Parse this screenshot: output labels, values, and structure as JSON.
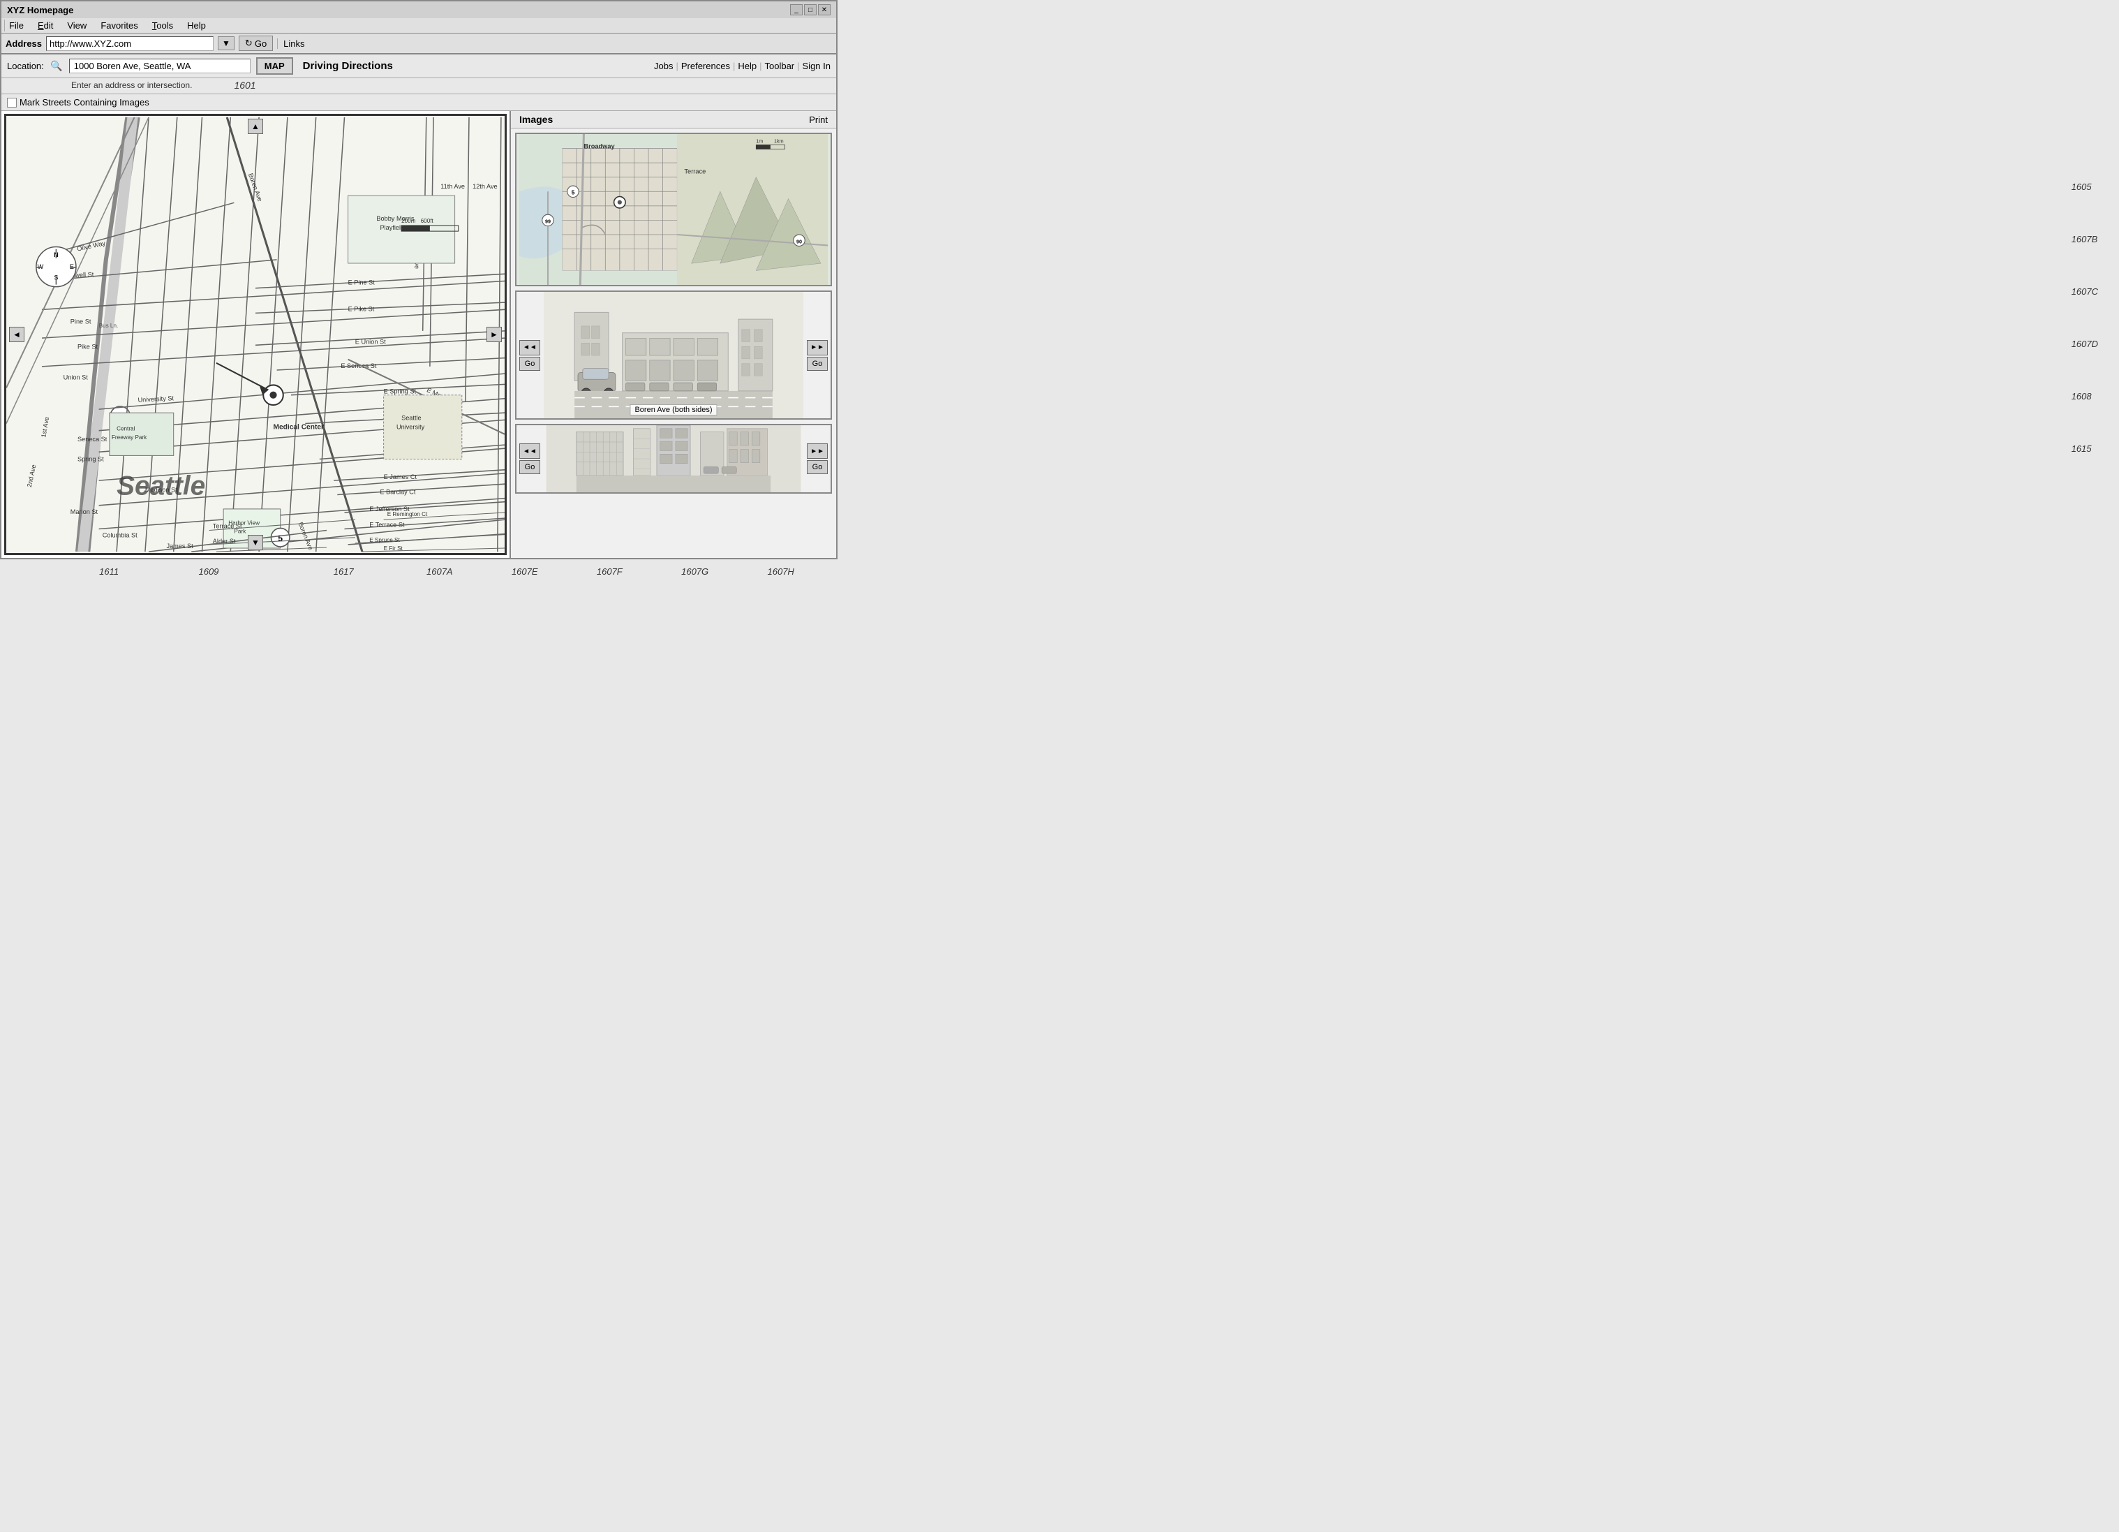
{
  "window": {
    "title": "XYZ Homepage",
    "controls": [
      "_",
      "□",
      "✕"
    ]
  },
  "menubar": {
    "items": [
      {
        "label": "File",
        "underline": 0
      },
      {
        "label": "Edit",
        "underline": 0
      },
      {
        "label": "View",
        "underline": 0
      },
      {
        "label": "Favorites",
        "underline": 0
      },
      {
        "label": "Tools",
        "underline": 0
      },
      {
        "label": "Help",
        "underline": 0
      }
    ]
  },
  "addressbar": {
    "label": "Address",
    "url": "http://www.XYZ.com",
    "go_label": "Go",
    "links_label": "Links"
  },
  "toolbar": {
    "location_label": "Location:",
    "search_placeholder": "1000 Boren Ave, Seattle, WA",
    "map_btn": "MAP",
    "driving_directions_btn": "Driving Directions",
    "hint_text": "Enter an address or intersection.",
    "ref_number": "1601",
    "nav_links": [
      "Jobs",
      "Preferences",
      "Help",
      "Toolbar",
      "Sign In"
    ]
  },
  "options": {
    "mark_streets_label": "Mark Streets Containing Images"
  },
  "map": {
    "city_label": "Seattle",
    "nav_arrows": [
      "▲",
      "▼",
      "◄",
      "►"
    ]
  },
  "images_panel": {
    "title": "Images",
    "print_label": "Print",
    "street_name": "Boren Ave (both sides)"
  },
  "ref_labels": {
    "label_1607A": "1607A",
    "label_1607B": "1607B",
    "label_1607C": "1607C",
    "label_1607D": "1607D",
    "label_1607E": "1607E",
    "label_1607F": "1607F",
    "label_1607G": "1607G",
    "label_1607H": "1607H",
    "label_1608": "1608",
    "label_1609": "1609",
    "label_1611": "1611",
    "label_1615": "1615",
    "label_1617": "1617",
    "label_1605": "1605"
  }
}
